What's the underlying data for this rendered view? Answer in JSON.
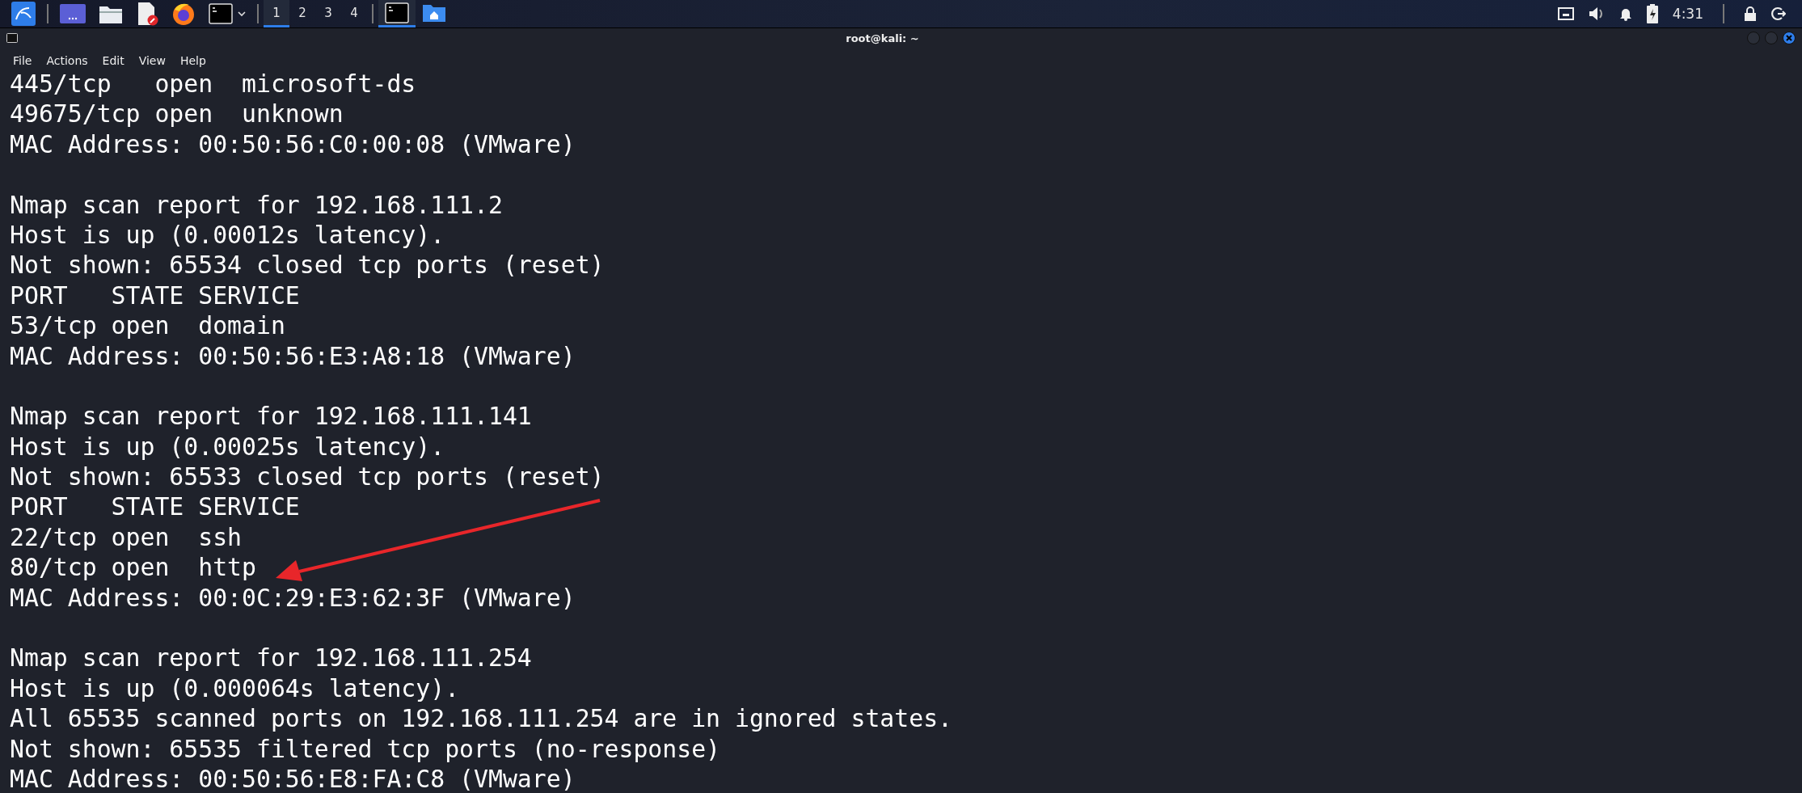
{
  "taskbar": {
    "launchers": [
      {
        "kind": "menu"
      },
      {
        "kind": "desktop"
      },
      {
        "kind": "files"
      },
      {
        "kind": "editor"
      },
      {
        "kind": "browser"
      },
      {
        "kind": "terminal"
      }
    ],
    "workspaces": [
      {
        "label": "1",
        "selected": true
      },
      {
        "label": "2",
        "selected": false
      },
      {
        "label": "3",
        "selected": false
      },
      {
        "label": "4",
        "selected": false
      }
    ],
    "tasks": [
      {
        "kind": "terminal",
        "selected": true
      },
      {
        "kind": "home-folder",
        "selected": false
      }
    ],
    "clock": "4:31"
  },
  "window": {
    "title": "root@kali: ~",
    "menu": [
      "File",
      "Actions",
      "Edit",
      "View",
      "Help"
    ]
  },
  "terminal": {
    "blocks": [
      {
        "lines": [
          "445/tcp   open  microsoft-ds",
          "49675/tcp open  unknown",
          "MAC Address: 00:50:56:C0:00:08 (VMware)"
        ]
      },
      {
        "lines": [
          "Nmap scan report for 192.168.111.2",
          "Host is up (0.00012s latency).",
          "Not shown: 65534 closed tcp ports (reset)",
          "PORT   STATE SERVICE",
          "53/tcp open  domain",
          "MAC Address: 00:50:56:E3:A8:18 (VMware)"
        ]
      },
      {
        "lines": [
          "Nmap scan report for 192.168.111.141",
          "Host is up (0.00025s latency).",
          "Not shown: 65533 closed tcp ports (reset)",
          "PORT   STATE SERVICE",
          "22/tcp open  ssh",
          "80/tcp open  http",
          "MAC Address: 00:0C:29:E3:62:3F (VMware)"
        ]
      },
      {
        "lines": [
          "Nmap scan report for 192.168.111.254",
          "Host is up (0.000064s latency).",
          "All 65535 scanned ports on 192.168.111.254 are in ignored states.",
          "Not shown: 65535 filtered tcp ports (no-response)",
          "MAC Address: 00:50:56:E8:FA:C8 (VMware)"
        ]
      }
    ]
  }
}
